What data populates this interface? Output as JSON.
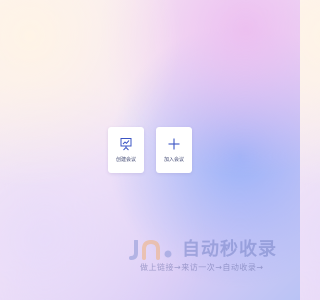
{
  "actions": [
    {
      "label": "创建会议",
      "icon": "whiteboard-chart-icon"
    },
    {
      "label": "加入会议",
      "icon": "plus-icon"
    }
  ],
  "watermark": {
    "title": "自动秒收录",
    "subtitle": "做上链接→来访一次→自动收录→",
    "logo": "jn-logo"
  },
  "colors": {
    "icon": "#3b54c4",
    "label": "#3d4570",
    "watermark": "#7a86c8"
  }
}
